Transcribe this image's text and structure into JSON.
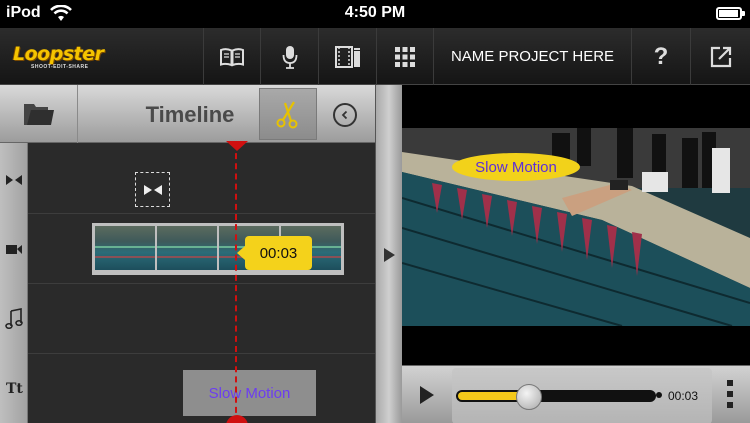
{
  "status_bar": {
    "carrier": "iPod",
    "time": "4:50 PM"
  },
  "toolbar": {
    "logo_text": "Loopster",
    "logo_tagline": "SHOOT-EDIT-SHARE",
    "project_name": "NAME PROJECT HERE",
    "help_label": "?",
    "buttons": [
      "book-icon",
      "microphone-icon",
      "film-icon",
      "grid-icon",
      "help-icon",
      "share-icon"
    ]
  },
  "timeline": {
    "title": "Timeline",
    "tracks": [
      "transition",
      "video",
      "audio",
      "text"
    ],
    "clip_time": "00:03",
    "text_clip_label": "Slow Motion"
  },
  "preview": {
    "caption": "Slow Motion",
    "duration": "00:03",
    "playback_progress": 0.36
  },
  "colors": {
    "accent_yellow": "#f4d21b",
    "playhead_red": "#d01010",
    "caption_purple": "#5c2fd8"
  }
}
